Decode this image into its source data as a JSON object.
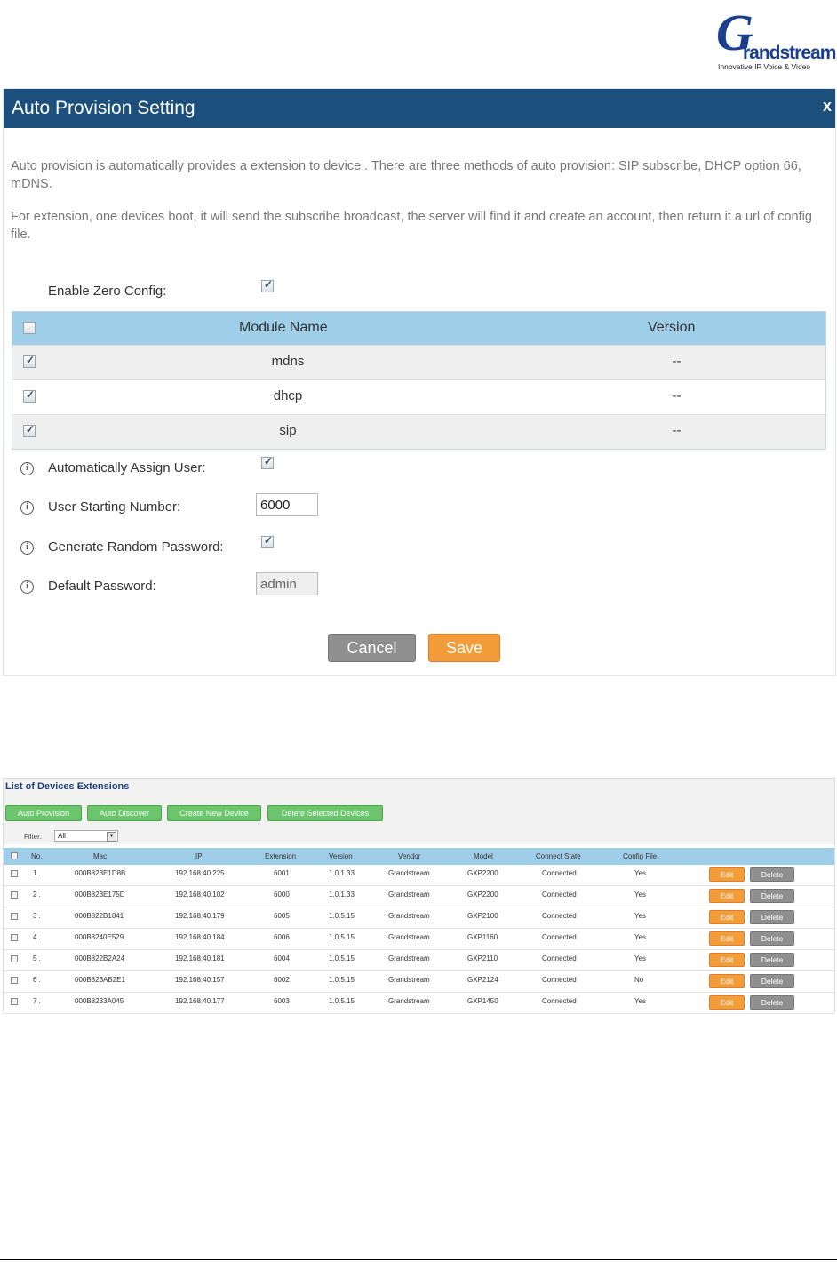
{
  "logo": {
    "mark": "G",
    "wordmark": "randstream",
    "tagline": "Innovative IP Voice & Video"
  },
  "dialog": {
    "title": "Auto Provision Setting",
    "close": "x",
    "desc1": "Auto provision is automatically provides a extension to device . There are three methods of auto provision: SIP subscribe, DHCP option 66, mDNS.",
    "desc2": "For extension, one devices boot, it will send the subscribe broadcast, the server will find it and create an account, then return it a url of config file.",
    "enable_zero_config_label": "Enable Zero Config:",
    "table": {
      "header_name": "Module Name",
      "header_version": "Version",
      "rows": [
        {
          "name": "mdns",
          "version": "--"
        },
        {
          "name": "dhcp",
          "version": "--"
        },
        {
          "name": "sip",
          "version": "--"
        }
      ]
    },
    "auto_assign_label": "Automatically Assign User:",
    "starting_number_label": "User Starting Number:",
    "starting_number_value": "6000",
    "random_password_label": "Generate Random Password:",
    "default_password_label": "Default Password:",
    "default_password_value": "admin",
    "cancel_label": "Cancel",
    "save_label": "Save"
  },
  "devices": {
    "title": "List of Devices Extensions",
    "buttons": {
      "auto_provision": "Auto Provision",
      "auto_discover": "Auto Discover",
      "create_new": "Create New Device",
      "delete_selected": "Delete Selected Devices"
    },
    "filter_label": "Filter:",
    "filter_value": "All",
    "columns": {
      "no": "No.",
      "mac": "Mac",
      "ip": "IP",
      "extension": "Extension",
      "version": "Version",
      "vendor": "Vendor",
      "model": "Model",
      "connect_state": "Connect State",
      "config_file": "Config File"
    },
    "edit_label": "Edit",
    "delete_label": "Delete",
    "rows": [
      {
        "no": "1 .",
        "mac": "000B823E1D8B",
        "ip": "192.168.40.225",
        "extension": "6001",
        "version": "1.0.1.33",
        "vendor": "Grandstream",
        "model": "GXP2200",
        "state": "Connected",
        "config": "Yes"
      },
      {
        "no": "2 .",
        "mac": "000B823E175D",
        "ip": "192.168.40.102",
        "extension": "6000",
        "version": "1.0.1.33",
        "vendor": "Grandstream",
        "model": "GXP2200",
        "state": "Connected",
        "config": "Yes"
      },
      {
        "no": "3 .",
        "mac": "000B822B1841",
        "ip": "192.168.40.179",
        "extension": "6005",
        "version": "1.0.5.15",
        "vendor": "Grandstream",
        "model": "GXP2100",
        "state": "Connected",
        "config": "Yes"
      },
      {
        "no": "4 .",
        "mac": "000B8240E529",
        "ip": "192.168.40.184",
        "extension": "6006",
        "version": "1.0.5.15",
        "vendor": "Grandstream",
        "model": "GXP1160",
        "state": "Connected",
        "config": "Yes"
      },
      {
        "no": "5 .",
        "mac": "000B822B2A24",
        "ip": "192.168.40.181",
        "extension": "6004",
        "version": "1.0.5.15",
        "vendor": "Grandstream",
        "model": "GXP2110",
        "state": "Connected",
        "config": "Yes"
      },
      {
        "no": "6 .",
        "mac": "000B823AB2E1",
        "ip": "192.168.40.157",
        "extension": "6002",
        "version": "1.0.5.15",
        "vendor": "Grandstream",
        "model": "GXP2124",
        "state": "Connected",
        "config": "No"
      },
      {
        "no": "7 .",
        "mac": "000B8233A045",
        "ip": "192.168.40.177",
        "extension": "6003",
        "version": "1.0.5.15",
        "vendor": "Grandstream",
        "model": "GXP1450",
        "state": "Connected",
        "config": "Yes"
      }
    ]
  },
  "colors": {
    "header_bg": "#1c4f7c",
    "table_header": "#9fcfe8",
    "save": "#f39c3a",
    "cancel": "#8f8f8f",
    "green_button": "#6cc56c"
  }
}
